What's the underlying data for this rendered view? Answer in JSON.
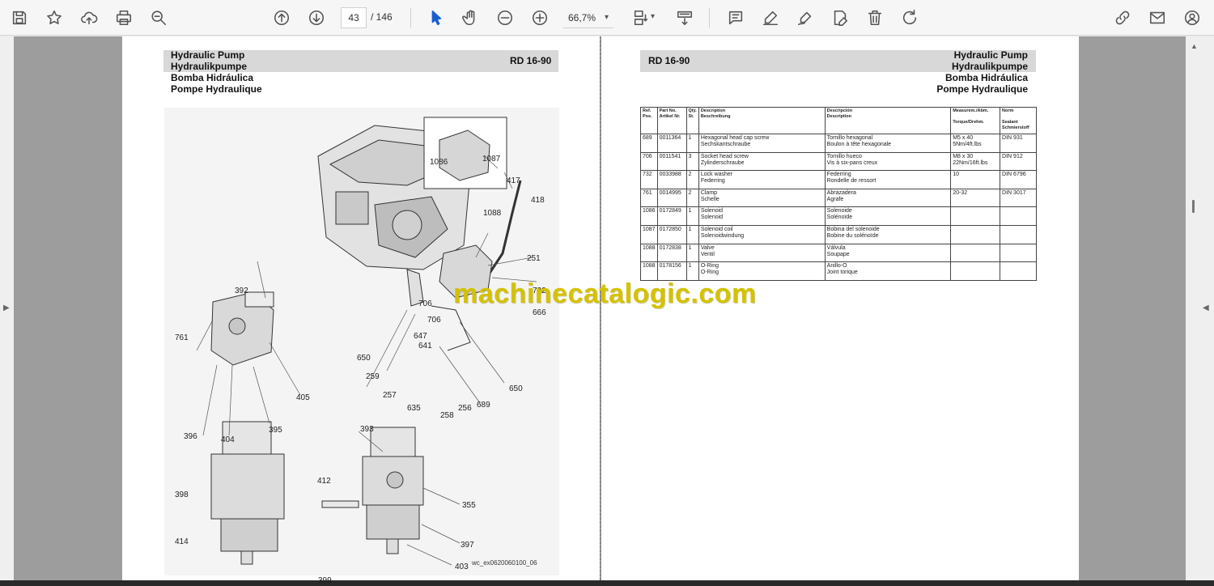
{
  "toolbar": {
    "page_current": "43",
    "page_total": "/ 146",
    "zoom": "66,7%",
    "zoom_caret": "▾",
    "organize_caret": "▾"
  },
  "left_page": {
    "title_lines": [
      "Hydraulic Pump",
      "Hydraulikpumpe",
      "Bomba Hidráulica",
      "Pompe Hydraulique"
    ],
    "model": "RD 16-90",
    "figure_id": "wc_ex0620060100_06",
    "callouts": [
      {
        "id": "c1086",
        "label": "1086"
      },
      {
        "id": "c1087",
        "label": "1087"
      },
      {
        "id": "c417",
        "label": "417"
      },
      {
        "id": "c418",
        "label": "418"
      },
      {
        "id": "c1088",
        "label": "1088"
      },
      {
        "id": "c251",
        "label": "251"
      },
      {
        "id": "c392",
        "label": "392"
      },
      {
        "id": "c732",
        "label": "732"
      },
      {
        "id": "c706a",
        "label": "706"
      },
      {
        "id": "c666",
        "label": "666"
      },
      {
        "id": "c706b",
        "label": "706"
      },
      {
        "id": "c761",
        "label": "761"
      },
      {
        "id": "c647",
        "label": "647"
      },
      {
        "id": "c641",
        "label": "641"
      },
      {
        "id": "c650a",
        "label": "650"
      },
      {
        "id": "c259",
        "label": "259"
      },
      {
        "id": "c405",
        "label": "405"
      },
      {
        "id": "c650b",
        "label": "650"
      },
      {
        "id": "c257",
        "label": "257"
      },
      {
        "id": "c689",
        "label": "689"
      },
      {
        "id": "c635",
        "label": "635"
      },
      {
        "id": "c256",
        "label": "256"
      },
      {
        "id": "c258",
        "label": "258"
      },
      {
        "id": "c395",
        "label": "395"
      },
      {
        "id": "c396",
        "label": "396"
      },
      {
        "id": "c404",
        "label": "404"
      },
      {
        "id": "c393",
        "label": "393"
      },
      {
        "id": "c412",
        "label": "412"
      },
      {
        "id": "c398",
        "label": "398"
      },
      {
        "id": "c355",
        "label": "355"
      },
      {
        "id": "c414",
        "label": "414"
      },
      {
        "id": "c397",
        "label": "397"
      },
      {
        "id": "c403",
        "label": "403"
      },
      {
        "id": "c399",
        "label": "399"
      }
    ]
  },
  "right_page": {
    "model": "RD 16-90",
    "title_lines": [
      "Hydraulic Pump",
      "Hydraulikpumpe",
      "Bomba Hidráulica",
      "Pompe Hydraulique"
    ],
    "table": {
      "headers": [
        [
          "Ref.",
          "Pos."
        ],
        [
          "Part No.",
          "Artikel Nr."
        ],
        [
          "Qty.",
          "St."
        ],
        [
          "Description",
          "Beschreibung"
        ],
        [
          "Descripción",
          "Description"
        ],
        [
          "Measurem./Abm.",
          "Torque/Drehm."
        ],
        [
          "Norm",
          "Sealant",
          "Schmierstoff"
        ]
      ],
      "rows": [
        {
          "pos": "689",
          "part": "0011364",
          "qty": "1",
          "desc_en": "Hexagonal head cap screw",
          "desc_de": "Sechskantschraube",
          "desc_es": "Tornillo hexagonal",
          "desc_fr": "Boulon à tête hexagonale",
          "meas": "M5 x 40",
          "torque": "5Nm/4ft.lbs",
          "norm": "DIN 931"
        },
        {
          "pos": "706",
          "part": "0011541",
          "qty": "3",
          "desc_en": "Socket head screw",
          "desc_de": "Zylinderschraube",
          "desc_es": "Tornillo hueco",
          "desc_fr": "Vis à six-pans creux",
          "meas": "M8 x 30",
          "torque": "22Nm/16ft.lbs",
          "norm": "DIN 912"
        },
        {
          "pos": "732",
          "part": "0033988",
          "qty": "2",
          "desc_en": "Lock washer",
          "desc_de": "Federring",
          "desc_es": "Federring",
          "desc_fr": "Rondelle de ressort",
          "meas": "10",
          "torque": "",
          "norm": "DIN 6796"
        },
        {
          "pos": "761",
          "part": "0014995",
          "qty": "2",
          "desc_en": "Clamp",
          "desc_de": "Schelle",
          "desc_es": "Abrazadera",
          "desc_fr": "Agrafe",
          "meas": "20-32",
          "torque": "",
          "norm": "DIN 3017"
        },
        {
          "pos": "1086",
          "part": "0172849",
          "qty": "1",
          "desc_en": "Solenoid",
          "desc_de": "Solenoid",
          "desc_es": "Solenoide",
          "desc_fr": "Solénoïde",
          "meas": "",
          "torque": "",
          "norm": ""
        },
        {
          "pos": "1087",
          "part": "0172850",
          "qty": "1",
          "desc_en": "Solenoid coil",
          "desc_de": "Solenoidwindung",
          "desc_es": "Bobina del solenoide",
          "desc_fr": "Bobine du solénoïde",
          "meas": "",
          "torque": "",
          "norm": ""
        },
        {
          "pos": "1088",
          "part": "0172838",
          "qty": "1",
          "desc_en": "Valve",
          "desc_de": "Ventil",
          "desc_es": "Válvula",
          "desc_fr": "Soupape",
          "meas": "",
          "torque": "",
          "norm": ""
        },
        {
          "pos": "1088",
          "part": "0178156",
          "qty": "1",
          "desc_en": "O-Ring",
          "desc_de": "O-Ring",
          "desc_es": "Anillo-O",
          "desc_fr": "Joint torique",
          "meas": "",
          "torque": "",
          "norm": ""
        }
      ]
    }
  },
  "watermark": "machinecatalogic.com"
}
